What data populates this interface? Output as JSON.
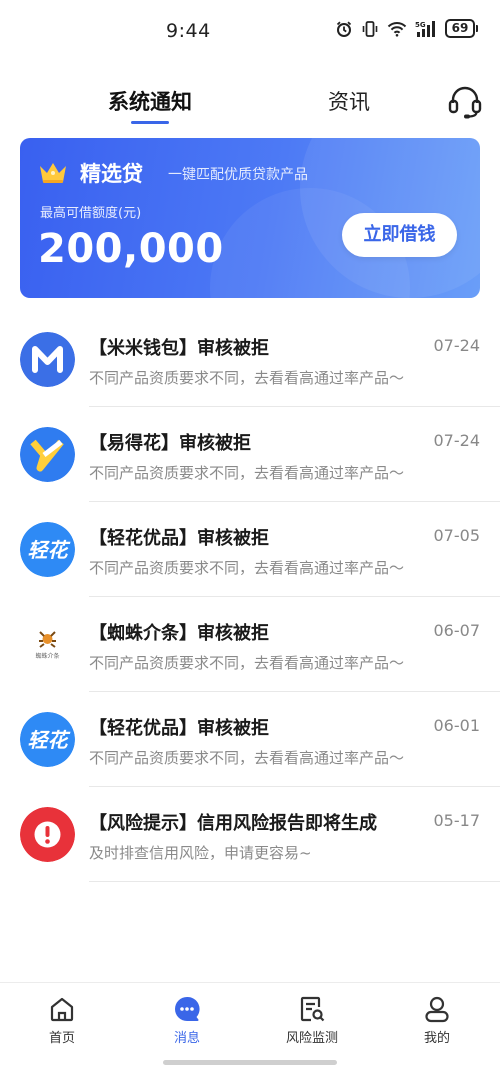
{
  "status_bar": {
    "time": "9:44",
    "battery": "69",
    "network": "5G",
    "icons": [
      "alarm-icon",
      "vibrate-icon",
      "wifi-icon",
      "signal-icon",
      "battery-icon"
    ]
  },
  "top_tabs": [
    {
      "label": "系统通知",
      "active": true
    },
    {
      "label": "资讯",
      "active": false
    }
  ],
  "support_icon": "headset-icon",
  "banner": {
    "icon": "crown-icon",
    "title": "精选贷",
    "subtitle": "一键匹配优质贷款产品",
    "label": "最高可借额度(元)",
    "amount": "200,000",
    "button_label": "立即借钱",
    "colors": {
      "from": "#3960f0",
      "to": "#6a9ef8"
    }
  },
  "messages": [
    {
      "title": "【米米钱包】审核被拒",
      "desc": "不同产品资质要求不同，去看看高通过率产品～",
      "date": "07-24",
      "avatar": "mimi-wallet-logo"
    },
    {
      "title": "【易得花】审核被拒",
      "desc": "不同产品资质要求不同，去看看高通过率产品～",
      "date": "07-24",
      "avatar": "yidehua-logo"
    },
    {
      "title": "【轻花优品】审核被拒",
      "desc": "不同产品资质要求不同，去看看高通过率产品～",
      "date": "07-05",
      "avatar": "qinghua-logo",
      "logo_text": "轻花"
    },
    {
      "title": "【蜘蛛介条】审核被拒",
      "desc": "不同产品资质要求不同，去看看高通过率产品～",
      "date": "06-07",
      "avatar": "spider-logo",
      "logo_text": "蜘蛛介条"
    },
    {
      "title": "【轻花优品】审核被拒",
      "desc": "不同产品资质要求不同，去看看高通过率产品～",
      "date": "06-01",
      "avatar": "qinghua-logo",
      "logo_text": "轻花"
    },
    {
      "title": "【风险提示】信用风险报告即将生成",
      "desc": "及时排查信用风险，申请更容易~",
      "date": "05-17",
      "avatar": "alert-icon"
    }
  ],
  "bottom_nav": [
    {
      "label": "首页",
      "icon": "home-icon",
      "active": false
    },
    {
      "label": "消息",
      "icon": "message-icon",
      "active": true
    },
    {
      "label": "风险监测",
      "icon": "risk-report-icon",
      "active": false
    },
    {
      "label": "我的",
      "icon": "user-icon",
      "active": false
    }
  ],
  "colors": {
    "accent": "#3a66e8",
    "alert": "#e8323a",
    "divider": "#e8e8e8"
  }
}
